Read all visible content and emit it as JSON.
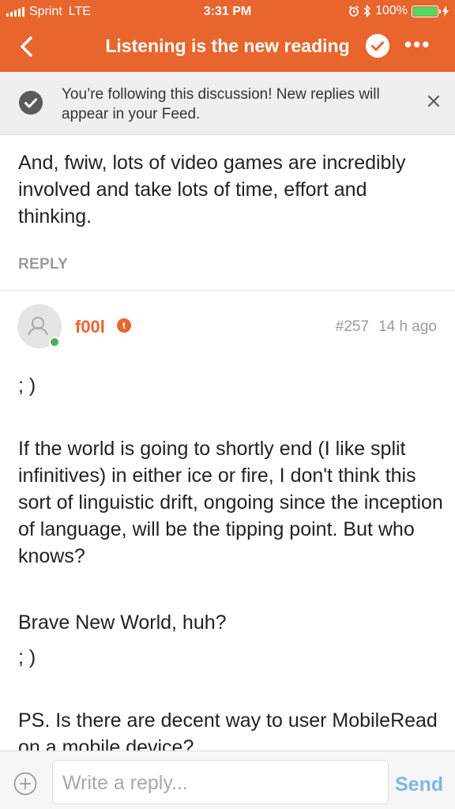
{
  "status_bar": {
    "carrier": "Sprint",
    "network": "LTE",
    "time": "3:31 PM",
    "battery": "100%",
    "battery_level": 1.0,
    "icons": [
      "signal-icon",
      "alarm-icon",
      "bluetooth-icon",
      "battery-icon",
      "charging-icon"
    ]
  },
  "nav": {
    "title": "Listening is the new reading",
    "icons": [
      "back-chevron-icon",
      "followed-check-icon",
      "more-options-icon"
    ]
  },
  "banner": {
    "message": "You’re following this discussion! New replies will appear in your Feed."
  },
  "previous_post": {
    "text": "And, fwiw, lots of video games are incredibly involved and take lots of time, effort and thinking.",
    "reply_label": "REPLY"
  },
  "post": {
    "username": "f00l",
    "badge_letter": "t",
    "number": "#257",
    "time": "14 h ago",
    "paragraphs": [
      "; )",
      "If the world is going to shortly end (I like split infinitives) in either ice or fire, I don't think this sort of linguistic drift, ongoing since the inception of language, will be the tipping point. But who knows?",
      "Brave New World, huh?",
      "; )",
      "PS. Is there are decent way to user MobileRead on a mobile device?"
    ]
  },
  "composer": {
    "placeholder": "Write a reply...",
    "send_label": "Send"
  },
  "colors": {
    "brand": "#e8652e",
    "online": "#4caf50",
    "send": "#7fb7e6",
    "battery": "#4cd964"
  }
}
